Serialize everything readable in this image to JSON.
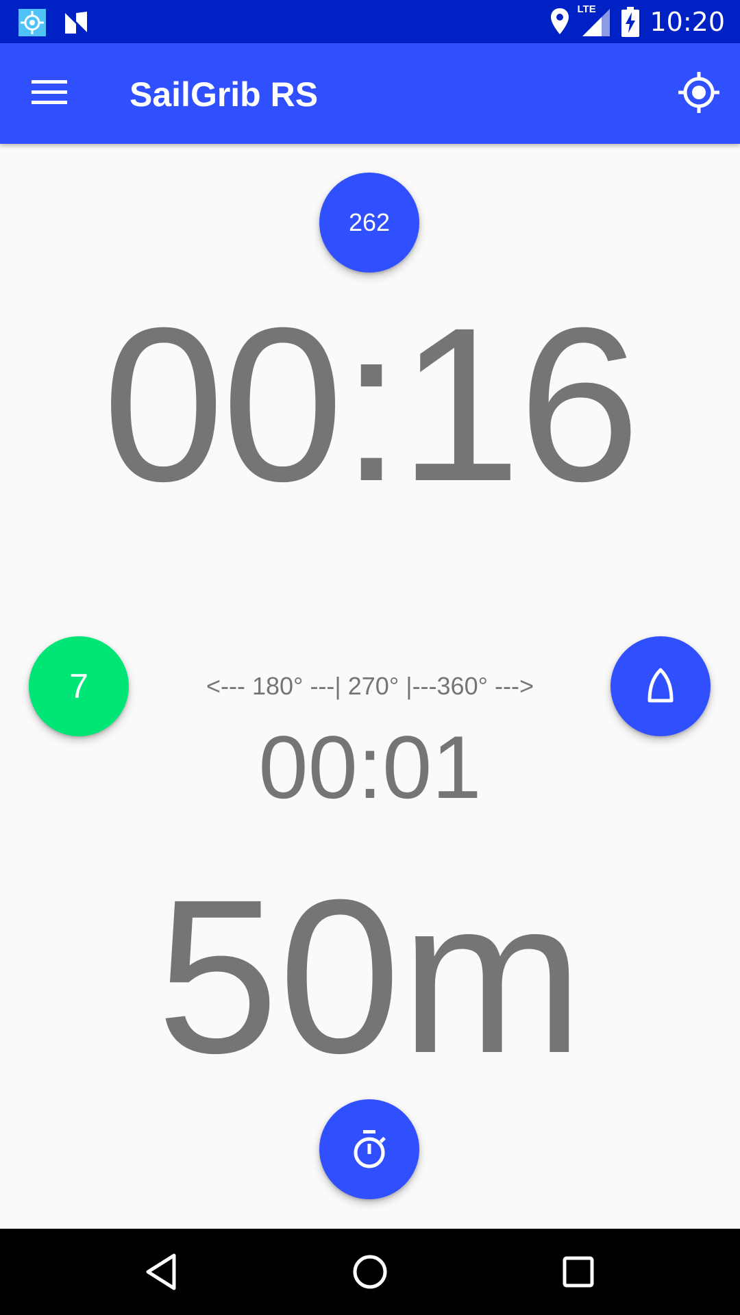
{
  "status_bar": {
    "time": "10:20",
    "network_label": "LTE",
    "icons": [
      "gps-app-icon",
      "n-app-icon",
      "location-icon",
      "signal-icon",
      "battery-charging-icon"
    ]
  },
  "app_bar": {
    "title": "SailGrib RS",
    "menu_icon": "hamburger-menu-icon",
    "action_icon": "my-location-icon"
  },
  "heading_button": {
    "label": "262"
  },
  "countdown": {
    "value": "00:16"
  },
  "count_button": {
    "label": "7"
  },
  "angle_scale": {
    "text": "<--- 180° ---| 270° |---360° --->"
  },
  "secondary_timer": {
    "value": "00:01"
  },
  "distance": {
    "value": "50m"
  },
  "boat_button": {
    "icon": "boat-icon"
  },
  "timer_button": {
    "icon": "stopwatch-icon"
  },
  "nav_bar": {
    "icons": [
      "back-icon",
      "home-icon",
      "recents-icon"
    ]
  },
  "colors": {
    "status_bar": "#0022c4",
    "app_bar": "#304ffe",
    "accent_blue": "#304ffe",
    "accent_green": "#00e676",
    "text_grey": "#757575",
    "background": "#fafafa"
  }
}
